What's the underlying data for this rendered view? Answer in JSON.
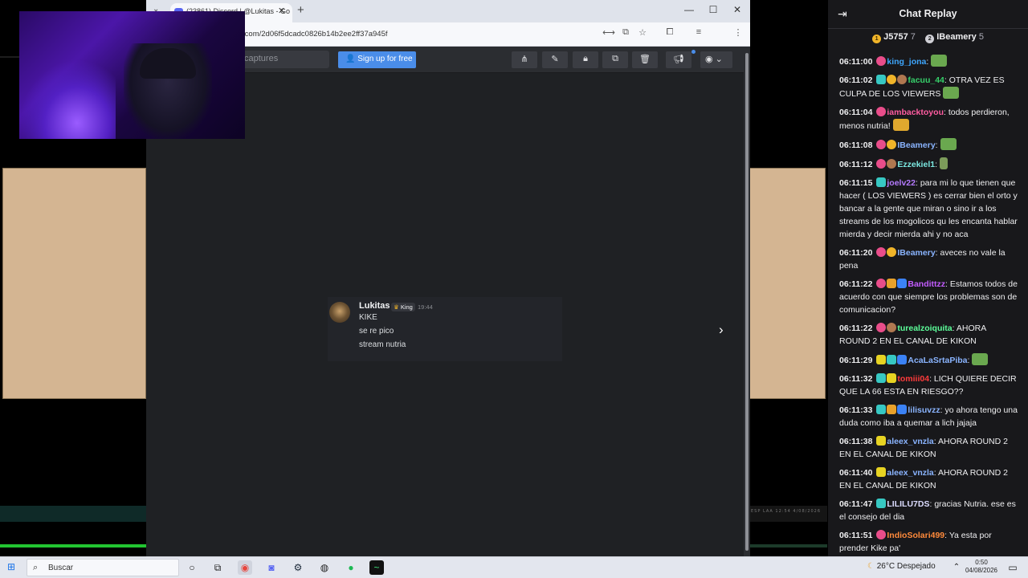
{
  "browser": {
    "tab_title": "(23861) Discord | @Lukitas - Go",
    "url": "zo.com/2d06f5dcadc0826b14b2ee2ff37a945f",
    "toolbar": {
      "captures_placeholder": "captures",
      "signup_label": "Sign up for free"
    }
  },
  "discord_message": {
    "author": "Lukitas",
    "role": "King",
    "time": "19:44",
    "lines": [
      "KIKE",
      "se re pico",
      "stream nutria"
    ]
  },
  "chat": {
    "title": "Chat Replay",
    "leaderboard": [
      {
        "name": "J5757",
        "count": "7",
        "rank": "1"
      },
      {
        "name": "IBeamery",
        "count": "5",
        "rank": "2"
      }
    ],
    "messages": [
      {
        "time": "06:11:00",
        "user": "king_jona",
        "color": "#3ea7ff",
        "text": ""
      },
      {
        "time": "06:11:02",
        "user": "facuu_44",
        "color": "#36d06a",
        "text": "OTRA VEZ ES CULPA DE LOS VIEWERS"
      },
      {
        "time": "06:11:04",
        "user": "iambacktoyou",
        "color": "#ff5ca1",
        "text": "todos perdieron, menos nutria!"
      },
      {
        "time": "06:11:08",
        "user": "IBeamery",
        "color": "#8ab4ff",
        "text": ""
      },
      {
        "time": "06:11:12",
        "user": "Ezzekiel1",
        "color": "#7be7e0",
        "text": ""
      },
      {
        "time": "06:11:15",
        "user": "joelv22",
        "color": "#b57bff",
        "text": "para mi lo que tienen que hacer ( LOS VIEWERS ) es cerrar bien el orto y bancar a la gente que miran o sino ir a los streams de los mogolicos qu les encanta hablar mierda y decir mierda ahi y no aca"
      },
      {
        "time": "06:11:20",
        "user": "IBeamery",
        "color": "#8ab4ff",
        "text": "aveces no vale la pena"
      },
      {
        "time": "06:11:22",
        "user": "Bandittzz",
        "color": "#c35cff",
        "text": "Estamos todos de acuerdo con que siempre los problemas son de comunicacion?"
      },
      {
        "time": "06:11:22",
        "user": "turealzoiquita",
        "color": "#5cff9a",
        "text": "AHORA ROUND 2 EN EL CANAL DE KIKON"
      },
      {
        "time": "06:11:29",
        "user": "AcaLaSrtaPiba",
        "color": "#8ab4ff",
        "text": ""
      },
      {
        "time": "06:11:32",
        "user": "tomiii04",
        "color": "#ff3b3b",
        "text": "LICH QUIERE DECIR QUE LA 66 ESTA EN RIESGO??"
      },
      {
        "time": "06:11:33",
        "user": "lilisuvzz",
        "color": "#8ab4ff",
        "text": "yo ahora tengo una duda como iba a quemar a lich jajaja"
      },
      {
        "time": "06:11:38",
        "user": "aleex_vnzla",
        "color": "#8ab4ff",
        "text": "AHORA ROUND 2 EN EL CANAL DE KIKON"
      },
      {
        "time": "06:11:40",
        "user": "aleex_vnzla",
        "color": "#8ab4ff",
        "text": "AHORA ROUND 2 EN EL CANAL DE KIKON"
      },
      {
        "time": "06:11:47",
        "user": "LILILU7DS",
        "color": "#dcdcff",
        "text": "gracias Nutria. ese es el consejo del dia"
      },
      {
        "time": "06:11:51",
        "user": "IndioSolari499",
        "color": "#ff8a3b",
        "text": "Ya esta por prender Kike pa'"
      }
    ]
  },
  "taskbar": {
    "search_placeholder": "Buscar",
    "weather": "26°C  Despejado",
    "time": "0:50",
    "date": "04/08/2026"
  },
  "mini_taskbar_text": "ESP LAA 12:54 4/08/2026"
}
